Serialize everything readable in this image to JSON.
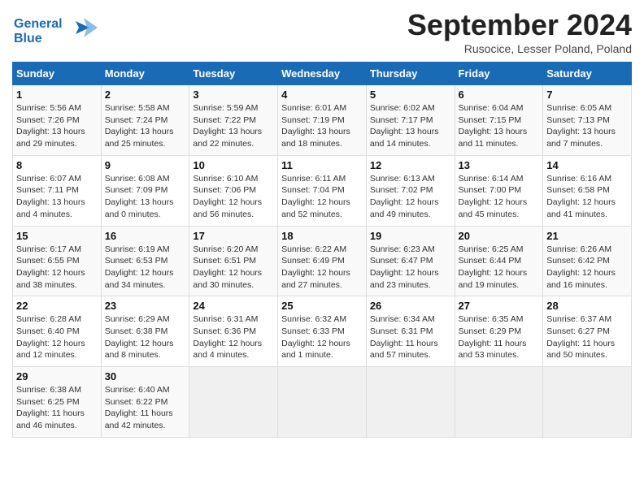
{
  "header": {
    "logo_line1": "General",
    "logo_line2": "Blue",
    "month_title": "September 2024",
    "location": "Rusocice, Lesser Poland, Poland"
  },
  "weekdays": [
    "Sunday",
    "Monday",
    "Tuesday",
    "Wednesday",
    "Thursday",
    "Friday",
    "Saturday"
  ],
  "weeks": [
    [
      {
        "day": "1",
        "info": "Sunrise: 5:56 AM\nSunset: 7:26 PM\nDaylight: 13 hours\nand 29 minutes."
      },
      {
        "day": "2",
        "info": "Sunrise: 5:58 AM\nSunset: 7:24 PM\nDaylight: 13 hours\nand 25 minutes."
      },
      {
        "day": "3",
        "info": "Sunrise: 5:59 AM\nSunset: 7:22 PM\nDaylight: 13 hours\nand 22 minutes."
      },
      {
        "day": "4",
        "info": "Sunrise: 6:01 AM\nSunset: 7:19 PM\nDaylight: 13 hours\nand 18 minutes."
      },
      {
        "day": "5",
        "info": "Sunrise: 6:02 AM\nSunset: 7:17 PM\nDaylight: 13 hours\nand 14 minutes."
      },
      {
        "day": "6",
        "info": "Sunrise: 6:04 AM\nSunset: 7:15 PM\nDaylight: 13 hours\nand 11 minutes."
      },
      {
        "day": "7",
        "info": "Sunrise: 6:05 AM\nSunset: 7:13 PM\nDaylight: 13 hours\nand 7 minutes."
      }
    ],
    [
      {
        "day": "8",
        "info": "Sunrise: 6:07 AM\nSunset: 7:11 PM\nDaylight: 13 hours\nand 4 minutes."
      },
      {
        "day": "9",
        "info": "Sunrise: 6:08 AM\nSunset: 7:09 PM\nDaylight: 13 hours\nand 0 minutes."
      },
      {
        "day": "10",
        "info": "Sunrise: 6:10 AM\nSunset: 7:06 PM\nDaylight: 12 hours\nand 56 minutes."
      },
      {
        "day": "11",
        "info": "Sunrise: 6:11 AM\nSunset: 7:04 PM\nDaylight: 12 hours\nand 52 minutes."
      },
      {
        "day": "12",
        "info": "Sunrise: 6:13 AM\nSunset: 7:02 PM\nDaylight: 12 hours\nand 49 minutes."
      },
      {
        "day": "13",
        "info": "Sunrise: 6:14 AM\nSunset: 7:00 PM\nDaylight: 12 hours\nand 45 minutes."
      },
      {
        "day": "14",
        "info": "Sunrise: 6:16 AM\nSunset: 6:58 PM\nDaylight: 12 hours\nand 41 minutes."
      }
    ],
    [
      {
        "day": "15",
        "info": "Sunrise: 6:17 AM\nSunset: 6:55 PM\nDaylight: 12 hours\nand 38 minutes."
      },
      {
        "day": "16",
        "info": "Sunrise: 6:19 AM\nSunset: 6:53 PM\nDaylight: 12 hours\nand 34 minutes."
      },
      {
        "day": "17",
        "info": "Sunrise: 6:20 AM\nSunset: 6:51 PM\nDaylight: 12 hours\nand 30 minutes."
      },
      {
        "day": "18",
        "info": "Sunrise: 6:22 AM\nSunset: 6:49 PM\nDaylight: 12 hours\nand 27 minutes."
      },
      {
        "day": "19",
        "info": "Sunrise: 6:23 AM\nSunset: 6:47 PM\nDaylight: 12 hours\nand 23 minutes."
      },
      {
        "day": "20",
        "info": "Sunrise: 6:25 AM\nSunset: 6:44 PM\nDaylight: 12 hours\nand 19 minutes."
      },
      {
        "day": "21",
        "info": "Sunrise: 6:26 AM\nSunset: 6:42 PM\nDaylight: 12 hours\nand 16 minutes."
      }
    ],
    [
      {
        "day": "22",
        "info": "Sunrise: 6:28 AM\nSunset: 6:40 PM\nDaylight: 12 hours\nand 12 minutes."
      },
      {
        "day": "23",
        "info": "Sunrise: 6:29 AM\nSunset: 6:38 PM\nDaylight: 12 hours\nand 8 minutes."
      },
      {
        "day": "24",
        "info": "Sunrise: 6:31 AM\nSunset: 6:36 PM\nDaylight: 12 hours\nand 4 minutes."
      },
      {
        "day": "25",
        "info": "Sunrise: 6:32 AM\nSunset: 6:33 PM\nDaylight: 12 hours\nand 1 minute."
      },
      {
        "day": "26",
        "info": "Sunrise: 6:34 AM\nSunset: 6:31 PM\nDaylight: 11 hours\nand 57 minutes."
      },
      {
        "day": "27",
        "info": "Sunrise: 6:35 AM\nSunset: 6:29 PM\nDaylight: 11 hours\nand 53 minutes."
      },
      {
        "day": "28",
        "info": "Sunrise: 6:37 AM\nSunset: 6:27 PM\nDaylight: 11 hours\nand 50 minutes."
      }
    ],
    [
      {
        "day": "29",
        "info": "Sunrise: 6:38 AM\nSunset: 6:25 PM\nDaylight: 11 hours\nand 46 minutes."
      },
      {
        "day": "30",
        "info": "Sunrise: 6:40 AM\nSunset: 6:22 PM\nDaylight: 11 hours\nand 42 minutes."
      },
      {
        "day": "",
        "info": ""
      },
      {
        "day": "",
        "info": ""
      },
      {
        "day": "",
        "info": ""
      },
      {
        "day": "",
        "info": ""
      },
      {
        "day": "",
        "info": ""
      }
    ]
  ]
}
